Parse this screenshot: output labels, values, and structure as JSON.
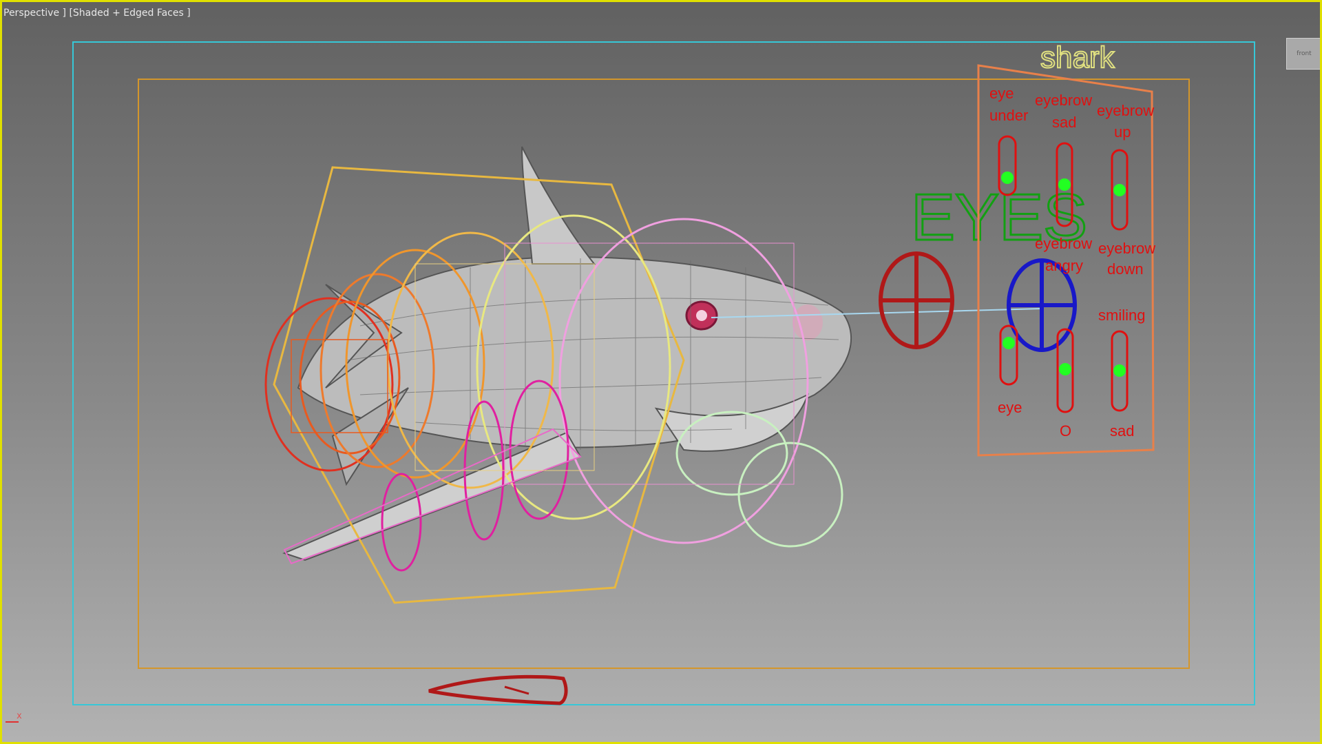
{
  "viewport": {
    "label": "Perspective ] [Shaded + Edged Faces ]",
    "viewcube_label": "front"
  },
  "panel": {
    "title": "shark",
    "sliders": [
      {
        "label_line1": "eye",
        "label_line2": "under",
        "level": 0.7
      },
      {
        "label_line1": "eyebrow",
        "label_line2": "sad",
        "level": 0.5
      },
      {
        "label_line1": "eyebrow",
        "label_line2": "up",
        "level": 0.5
      },
      {
        "label_line1": "eye",
        "label_line2": "",
        "level": 0.7
      },
      {
        "label_line1": "O",
        "label_line2": "",
        "level": 0.55
      },
      {
        "label_line1": "sad",
        "label_line2": "",
        "level": 0.5
      }
    ],
    "extra_labels": {
      "eyebrow_angry_1": "eyebrow",
      "eyebrow_angry_2": "angry",
      "eyebrow_down_1": "eyebrow",
      "eyebrow_down_2": "down",
      "smiling": "smiling"
    }
  },
  "eyes_label": "EYES",
  "axis": "x",
  "colors": {
    "viewport_border": "#e0e000",
    "safe_frame": "#36c8d8",
    "render_frame": "#d4962a",
    "control_red": "#e01010",
    "knob_green": "#22ff22",
    "eyes_green": "#12a012",
    "eye_ctrl_red": "#b01818",
    "eye_ctrl_blue": "#1818c8"
  }
}
